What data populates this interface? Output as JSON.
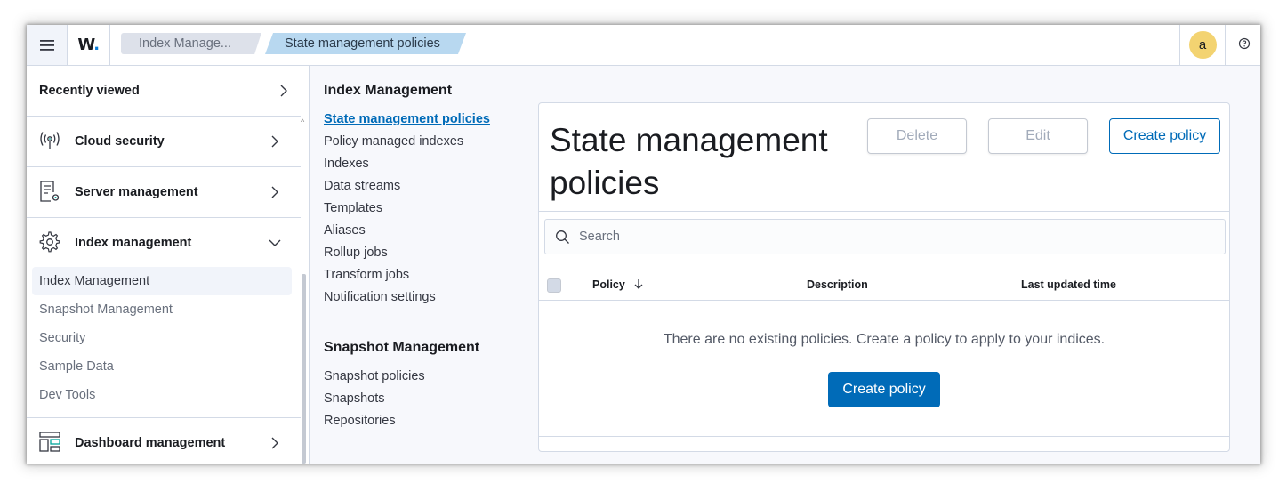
{
  "header": {
    "logo_text": "W",
    "logo_dot": ".",
    "breadcrumbs": [
      "Index Manage...",
      "State management policies"
    ],
    "avatar_initial": "a"
  },
  "sidebar": {
    "recently_viewed": "Recently viewed",
    "groups": [
      {
        "label": "Cloud security",
        "icon": "cloud-security-icon"
      },
      {
        "label": "Server management",
        "icon": "server-management-icon"
      },
      {
        "label": "Index management",
        "icon": "gear-icon"
      }
    ],
    "index_management_items": [
      "Index Management",
      "Snapshot Management",
      "Security",
      "Sample Data",
      "Dev Tools"
    ],
    "dashboard_management": "Dashboard management"
  },
  "midnav": {
    "index_heading": "Index Management",
    "index_links": [
      "State management policies",
      "Policy managed indexes",
      "Indexes",
      "Data streams",
      "Templates",
      "Aliases",
      "Rollup jobs",
      "Transform jobs",
      "Notification settings"
    ],
    "snapshot_heading": "Snapshot Management",
    "snapshot_links": [
      "Snapshot policies",
      "Snapshots",
      "Repositories"
    ]
  },
  "panel": {
    "title_line1": "State management",
    "title_line2": "policies",
    "delete_label": "Delete",
    "edit_label": "Edit",
    "create_label": "Create policy",
    "search_placeholder": "Search",
    "columns": [
      "Policy",
      "Description",
      "Last updated time"
    ],
    "empty_message": "There are no existing policies. Create a policy to apply to your indices.",
    "empty_create_label": "Create policy"
  },
  "colors": {
    "primary": "#006bb8",
    "avatar": "#f3d371"
  }
}
